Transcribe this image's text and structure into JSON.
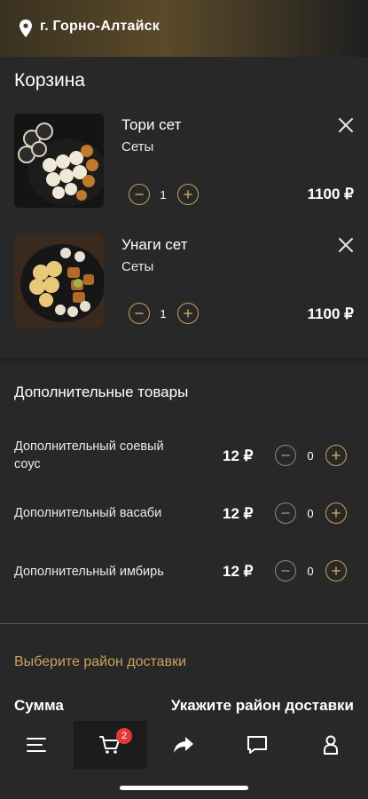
{
  "header": {
    "city": "г. Горно-Алтайск"
  },
  "cart": {
    "title": "Корзина",
    "items": [
      {
        "name": "Тори сет",
        "category": "Сеты",
        "quantity": "1",
        "price": "1100 ₽"
      },
      {
        "name": "Унаги сет",
        "category": "Сеты",
        "quantity": "1",
        "price": "1100 ₽"
      }
    ]
  },
  "extras": {
    "title": "Дополнительные товары",
    "items": [
      {
        "name": "Дополнительный соевый соус",
        "price": "12 ₽",
        "quantity": "0"
      },
      {
        "name": "Дополнительный васаби",
        "price": "12 ₽",
        "quantity": "0"
      },
      {
        "name": "Дополнительный имбирь",
        "price": "12 ₽",
        "quantity": "0"
      }
    ]
  },
  "delivery": {
    "select_label": "Выберите район доставки"
  },
  "summary": {
    "label": "Сумма",
    "value": "Укажите район доставки"
  },
  "tabbar": {
    "cart_badge": "2"
  },
  "colors": {
    "accent": "#c9a25a",
    "background": "#282828",
    "badge": "#e53935"
  }
}
